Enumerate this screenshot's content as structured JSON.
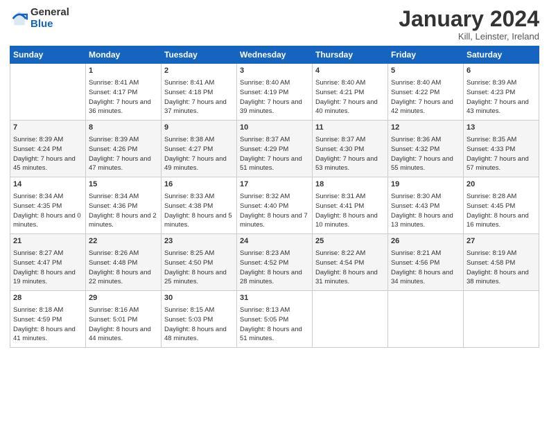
{
  "header": {
    "logo_general": "General",
    "logo_blue": "Blue",
    "month": "January 2024",
    "location": "Kill, Leinster, Ireland"
  },
  "days_of_week": [
    "Sunday",
    "Monday",
    "Tuesday",
    "Wednesday",
    "Thursday",
    "Friday",
    "Saturday"
  ],
  "weeks": [
    [
      {
        "day": "",
        "sunrise": "",
        "sunset": "",
        "daylight": ""
      },
      {
        "day": "1",
        "sunrise": "Sunrise: 8:41 AM",
        "sunset": "Sunset: 4:17 PM",
        "daylight": "Daylight: 7 hours and 36 minutes."
      },
      {
        "day": "2",
        "sunrise": "Sunrise: 8:41 AM",
        "sunset": "Sunset: 4:18 PM",
        "daylight": "Daylight: 7 hours and 37 minutes."
      },
      {
        "day": "3",
        "sunrise": "Sunrise: 8:40 AM",
        "sunset": "Sunset: 4:19 PM",
        "daylight": "Daylight: 7 hours and 39 minutes."
      },
      {
        "day": "4",
        "sunrise": "Sunrise: 8:40 AM",
        "sunset": "Sunset: 4:21 PM",
        "daylight": "Daylight: 7 hours and 40 minutes."
      },
      {
        "day": "5",
        "sunrise": "Sunrise: 8:40 AM",
        "sunset": "Sunset: 4:22 PM",
        "daylight": "Daylight: 7 hours and 42 minutes."
      },
      {
        "day": "6",
        "sunrise": "Sunrise: 8:39 AM",
        "sunset": "Sunset: 4:23 PM",
        "daylight": "Daylight: 7 hours and 43 minutes."
      }
    ],
    [
      {
        "day": "7",
        "sunrise": "Sunrise: 8:39 AM",
        "sunset": "Sunset: 4:24 PM",
        "daylight": "Daylight: 7 hours and 45 minutes."
      },
      {
        "day": "8",
        "sunrise": "Sunrise: 8:39 AM",
        "sunset": "Sunset: 4:26 PM",
        "daylight": "Daylight: 7 hours and 47 minutes."
      },
      {
        "day": "9",
        "sunrise": "Sunrise: 8:38 AM",
        "sunset": "Sunset: 4:27 PM",
        "daylight": "Daylight: 7 hours and 49 minutes."
      },
      {
        "day": "10",
        "sunrise": "Sunrise: 8:37 AM",
        "sunset": "Sunset: 4:29 PM",
        "daylight": "Daylight: 7 hours and 51 minutes."
      },
      {
        "day": "11",
        "sunrise": "Sunrise: 8:37 AM",
        "sunset": "Sunset: 4:30 PM",
        "daylight": "Daylight: 7 hours and 53 minutes."
      },
      {
        "day": "12",
        "sunrise": "Sunrise: 8:36 AM",
        "sunset": "Sunset: 4:32 PM",
        "daylight": "Daylight: 7 hours and 55 minutes."
      },
      {
        "day": "13",
        "sunrise": "Sunrise: 8:35 AM",
        "sunset": "Sunset: 4:33 PM",
        "daylight": "Daylight: 7 hours and 57 minutes."
      }
    ],
    [
      {
        "day": "14",
        "sunrise": "Sunrise: 8:34 AM",
        "sunset": "Sunset: 4:35 PM",
        "daylight": "Daylight: 8 hours and 0 minutes."
      },
      {
        "day": "15",
        "sunrise": "Sunrise: 8:34 AM",
        "sunset": "Sunset: 4:36 PM",
        "daylight": "Daylight: 8 hours and 2 minutes."
      },
      {
        "day": "16",
        "sunrise": "Sunrise: 8:33 AM",
        "sunset": "Sunset: 4:38 PM",
        "daylight": "Daylight: 8 hours and 5 minutes."
      },
      {
        "day": "17",
        "sunrise": "Sunrise: 8:32 AM",
        "sunset": "Sunset: 4:40 PM",
        "daylight": "Daylight: 8 hours and 7 minutes."
      },
      {
        "day": "18",
        "sunrise": "Sunrise: 8:31 AM",
        "sunset": "Sunset: 4:41 PM",
        "daylight": "Daylight: 8 hours and 10 minutes."
      },
      {
        "day": "19",
        "sunrise": "Sunrise: 8:30 AM",
        "sunset": "Sunset: 4:43 PM",
        "daylight": "Daylight: 8 hours and 13 minutes."
      },
      {
        "day": "20",
        "sunrise": "Sunrise: 8:28 AM",
        "sunset": "Sunset: 4:45 PM",
        "daylight": "Daylight: 8 hours and 16 minutes."
      }
    ],
    [
      {
        "day": "21",
        "sunrise": "Sunrise: 8:27 AM",
        "sunset": "Sunset: 4:47 PM",
        "daylight": "Daylight: 8 hours and 19 minutes."
      },
      {
        "day": "22",
        "sunrise": "Sunrise: 8:26 AM",
        "sunset": "Sunset: 4:48 PM",
        "daylight": "Daylight: 8 hours and 22 minutes."
      },
      {
        "day": "23",
        "sunrise": "Sunrise: 8:25 AM",
        "sunset": "Sunset: 4:50 PM",
        "daylight": "Daylight: 8 hours and 25 minutes."
      },
      {
        "day": "24",
        "sunrise": "Sunrise: 8:23 AM",
        "sunset": "Sunset: 4:52 PM",
        "daylight": "Daylight: 8 hours and 28 minutes."
      },
      {
        "day": "25",
        "sunrise": "Sunrise: 8:22 AM",
        "sunset": "Sunset: 4:54 PM",
        "daylight": "Daylight: 8 hours and 31 minutes."
      },
      {
        "day": "26",
        "sunrise": "Sunrise: 8:21 AM",
        "sunset": "Sunset: 4:56 PM",
        "daylight": "Daylight: 8 hours and 34 minutes."
      },
      {
        "day": "27",
        "sunrise": "Sunrise: 8:19 AM",
        "sunset": "Sunset: 4:58 PM",
        "daylight": "Daylight: 8 hours and 38 minutes."
      }
    ],
    [
      {
        "day": "28",
        "sunrise": "Sunrise: 8:18 AM",
        "sunset": "Sunset: 4:59 PM",
        "daylight": "Daylight: 8 hours and 41 minutes."
      },
      {
        "day": "29",
        "sunrise": "Sunrise: 8:16 AM",
        "sunset": "Sunset: 5:01 PM",
        "daylight": "Daylight: 8 hours and 44 minutes."
      },
      {
        "day": "30",
        "sunrise": "Sunrise: 8:15 AM",
        "sunset": "Sunset: 5:03 PM",
        "daylight": "Daylight: 8 hours and 48 minutes."
      },
      {
        "day": "31",
        "sunrise": "Sunrise: 8:13 AM",
        "sunset": "Sunset: 5:05 PM",
        "daylight": "Daylight: 8 hours and 51 minutes."
      },
      {
        "day": "",
        "sunrise": "",
        "sunset": "",
        "daylight": ""
      },
      {
        "day": "",
        "sunrise": "",
        "sunset": "",
        "daylight": ""
      },
      {
        "day": "",
        "sunrise": "",
        "sunset": "",
        "daylight": ""
      }
    ]
  ]
}
